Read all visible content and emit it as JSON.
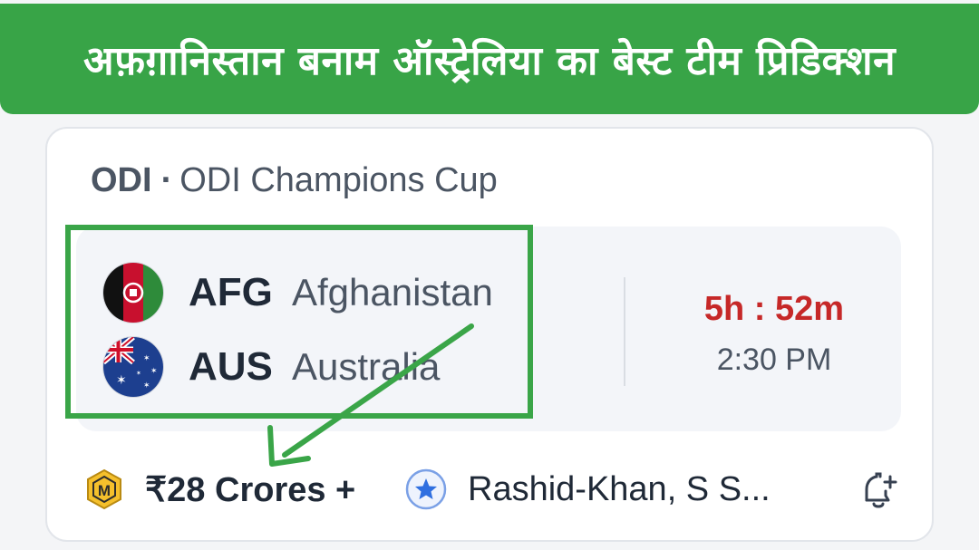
{
  "banner": {
    "title": "अफ़ग़ानिस्तान बनाम ऑस्ट्रेलिया का बेस्ट टीम प्रिडिक्शन"
  },
  "match": {
    "format": "ODI",
    "separator": "·",
    "tournament": "ODI Champions Cup",
    "teams": [
      {
        "code": "AFG",
        "name": "Afghanistan",
        "flag_icon": "afghanistan-flag-icon"
      },
      {
        "code": "AUS",
        "name": "Australia",
        "flag_icon": "australia-flag-icon"
      }
    ],
    "countdown": "5h : 52m",
    "start_time": "2:30 PM"
  },
  "footer": {
    "prize": "₹28 Crores +",
    "prize_icon": "mega-contest-icon",
    "expert": "Rashid-Khan, S S...",
    "expert_icon": "star-badge-icon",
    "reminder_icon": "bell-plus-icon"
  },
  "colors": {
    "banner_green": "#38a447",
    "highlight_green": "#3aa548",
    "countdown_red": "#c62828",
    "text_dark": "#1f2937",
    "text_muted": "#4b5563"
  }
}
